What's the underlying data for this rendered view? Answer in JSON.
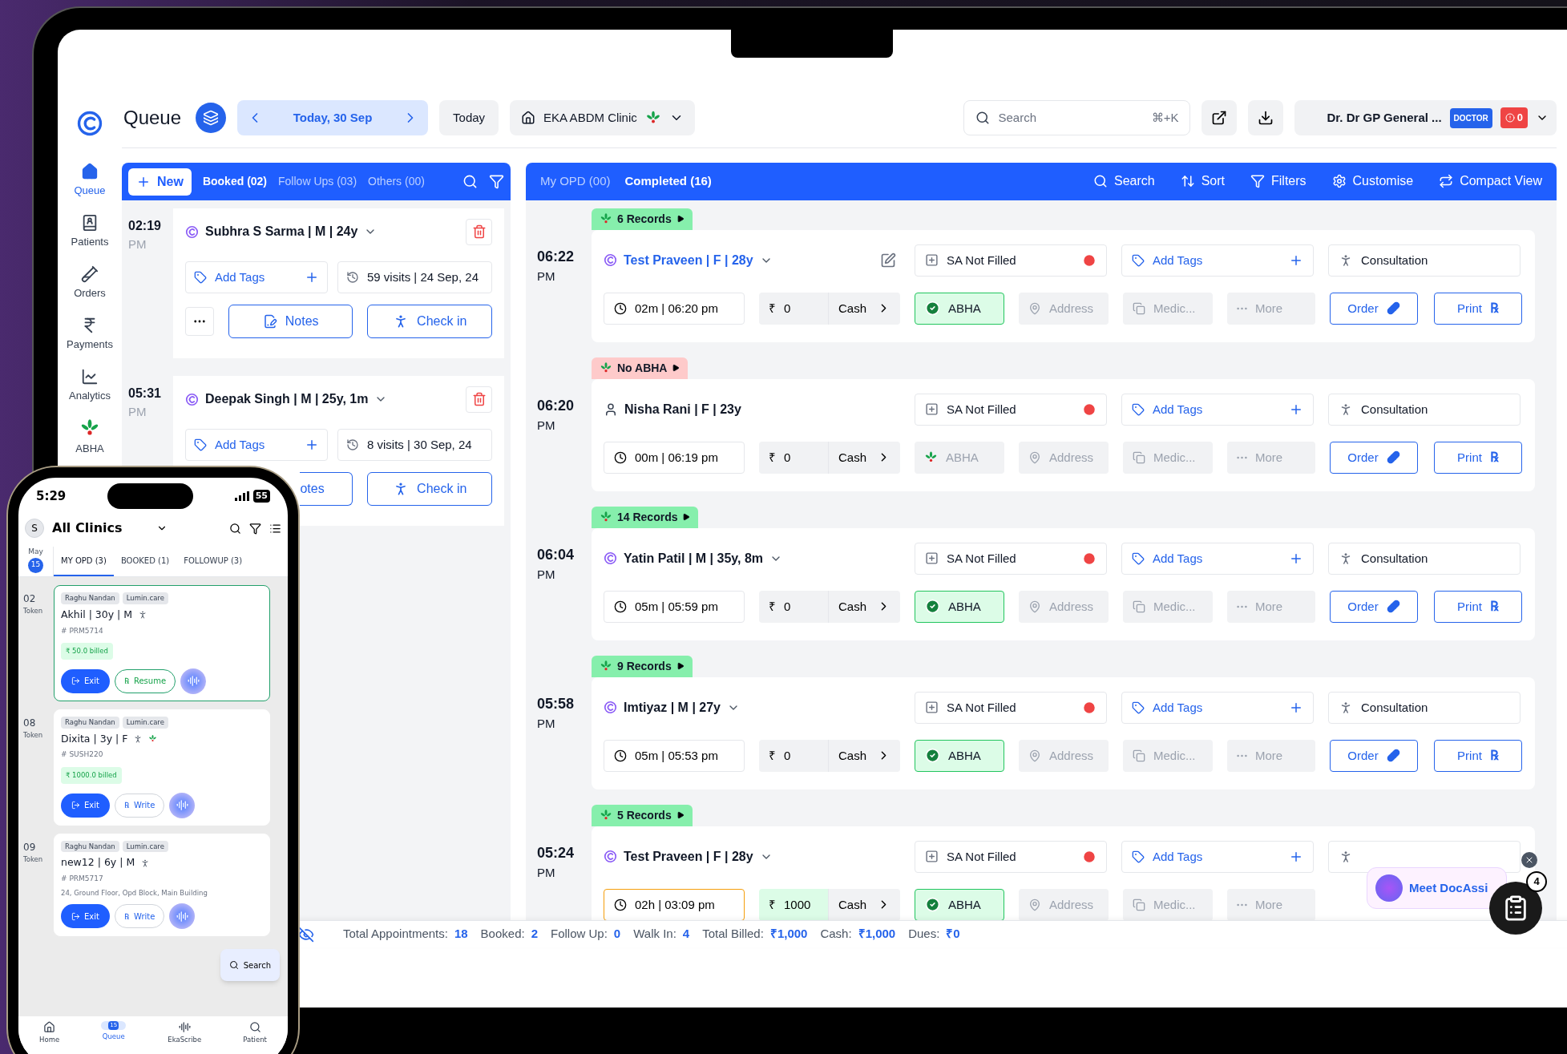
{
  "header": {
    "title": "Queue",
    "date": "Today, 30 Sep",
    "today_button": "Today",
    "clinic": "EKA ABDM Clinic",
    "search_placeholder": "Search",
    "shortcut": "⌘+K",
    "doctor": "Dr. Dr GP General ...",
    "role_badge": "DOCTOR",
    "alert_count": "0"
  },
  "sidebar": {
    "items": [
      {
        "label": "Queue",
        "selected": true
      },
      {
        "label": "Patients",
        "selected": false
      },
      {
        "label": "Orders",
        "selected": false
      },
      {
        "label": "Payments",
        "selected": false
      },
      {
        "label": "Analytics",
        "selected": false
      },
      {
        "label": "ABHA",
        "selected": false
      }
    ]
  },
  "booked_panel": {
    "new_button": "New",
    "tabs": [
      {
        "label": "Booked (02)",
        "selected": true
      },
      {
        "label": "Follow Ups (03)",
        "selected": false
      },
      {
        "label": "Others (00)",
        "selected": false
      }
    ],
    "appointments": [
      {
        "time": "02:19",
        "meridiem": "PM",
        "name": "Subhra S Sarma | M | 24y",
        "tags": "Add Tags",
        "visits": "59 visits | 24 Sep, 24",
        "notes": "Notes",
        "check_in": "Check in",
        "partly_hidden": false
      },
      {
        "time": "05:31",
        "meridiem": "PM",
        "name": "Deepak Singh | M | 25y, 1m",
        "tags": "Add Tags",
        "visits": "8 visits | 30 Sep, 24",
        "notes": "otes",
        "check_in": "Check in",
        "partly_hidden": true
      }
    ]
  },
  "completed_panel": {
    "tabs": [
      {
        "label": "My OPD (00)",
        "selected": false
      },
      {
        "label": "Completed (16)",
        "selected": true
      }
    ],
    "actions": [
      "Search",
      "Sort",
      "Filters",
      "Customise",
      "Compact View"
    ],
    "records": [
      {
        "badge": "6 Records",
        "badge_warning": false,
        "time": "06:22",
        "meridiem": "PM",
        "kind": "eka",
        "selected": true,
        "name": "Test Praveen | F | 28y",
        "sa": "SA Not Filled",
        "tags": "Add Tags",
        "visit_type": "Consultation",
        "duration": "02m | 06:20 pm",
        "overdue": false,
        "currency": "₹",
        "amount": "0",
        "paid": false,
        "payment": "Cash",
        "abha": "ABHA",
        "abha_linked": true,
        "address": "Address",
        "medic": "Medic...",
        "more": "More",
        "order": "Order",
        "print": "Print",
        "rx_mark": "℞"
      },
      {
        "badge": "No ABHA",
        "badge_warning": true,
        "time": "06:20",
        "meridiem": "PM",
        "kind": "guest",
        "selected": false,
        "name": "Nisha Rani | F | 23y",
        "sa": "SA Not Filled",
        "tags": "Add Tags",
        "visit_type": "Consultation",
        "duration": "00m | 06:19 pm",
        "overdue": false,
        "currency": "₹",
        "amount": "0",
        "paid": false,
        "payment": "Cash",
        "abha": "ABHA",
        "abha_linked": false,
        "address": "Address",
        "medic": "Medic...",
        "more": "More",
        "order": "Order",
        "print": "Print",
        "rx_mark": "℞"
      },
      {
        "badge": "14 Records",
        "badge_warning": false,
        "time": "06:04",
        "meridiem": "PM",
        "kind": "eka",
        "selected": false,
        "name": "Yatin Patil | M | 35y, 8m",
        "sa": "SA Not Filled",
        "tags": "Add Tags",
        "visit_type": "Consultation",
        "duration": "05m | 05:59 pm",
        "overdue": false,
        "currency": "₹",
        "amount": "0",
        "paid": false,
        "payment": "Cash",
        "abha": "ABHA",
        "abha_linked": true,
        "address": "Address",
        "medic": "Medic...",
        "more": "More",
        "order": "Order",
        "print": "Print",
        "rx_mark": "℞"
      },
      {
        "badge": "9 Records",
        "badge_warning": false,
        "time": "05:58",
        "meridiem": "PM",
        "kind": "eka",
        "selected": false,
        "name": "Imtiyaz | M | 27y",
        "sa": "SA Not Filled",
        "tags": "Add Tags",
        "visit_type": "Consultation",
        "duration": "05m | 05:53 pm",
        "overdue": false,
        "currency": "₹",
        "amount": "0",
        "paid": false,
        "payment": "Cash",
        "abha": "ABHA",
        "abha_linked": true,
        "address": "Address",
        "medic": "Medic...",
        "more": "More",
        "order": "Order",
        "print": "Print",
        "rx_mark": "℞"
      },
      {
        "badge": "5 Records",
        "badge_warning": false,
        "time": "05:24",
        "meridiem": "PM",
        "kind": "eka",
        "selected": false,
        "name": "Test Praveen | F | 28y",
        "sa": "SA Not Filled",
        "tags": "Add Tags",
        "duration": "02h | 03:09 pm",
        "overdue": true,
        "currency": "₹",
        "amount": "1000",
        "paid": true,
        "payment": "Cash",
        "abha": "ABHA",
        "abha_linked": true,
        "address": "Address",
        "medic": "Medic...",
        "more": "More"
      }
    ]
  },
  "status_bar": [
    {
      "label": "Total Appointments:",
      "value": "18"
    },
    {
      "label": "Booked:",
      "value": "2"
    },
    {
      "label": "Follow Up:",
      "value": "0"
    },
    {
      "label": "Walk In:",
      "value": "4"
    },
    {
      "label": "Total Billed:",
      "value": "₹1,000"
    },
    {
      "label": "Cash:",
      "value": "₹1,000"
    },
    {
      "label": "Dues:",
      "value": "₹0"
    }
  ],
  "assistant": {
    "label": "Meet DocAssi",
    "count": "4"
  },
  "phone": {
    "time": "5:29",
    "battery": "55",
    "avatar": "S",
    "clinic": "All Clinics",
    "month": "May",
    "day": "15",
    "tabs": [
      {
        "label": "MY OPD (3)",
        "selected": true
      },
      {
        "label": "BOOKED (1)",
        "selected": false
      },
      {
        "label": "FOLLOWUP (3)",
        "selected": false
      }
    ],
    "tokens": [
      {
        "token": "02",
        "token_label": "Token",
        "tags": [
          "Raghu Nandan",
          "Lumin.care"
        ],
        "name": "Akhil | 30y | M",
        "abha": false,
        "id": "# PRM5714",
        "billed": "₹  50.0 billed",
        "exit": "Exit",
        "rx_mark": "℞",
        "rx": "Resume",
        "selected": true
      },
      {
        "token": "08",
        "token_label": "Token",
        "tags": [
          "Raghu Nandan",
          "Lumin.care"
        ],
        "name": "Dixita | 3y | F",
        "abha": true,
        "id": "# SUSH220",
        "billed": "₹  1000.0 billed",
        "exit": "Exit",
        "rx_mark": "℞",
        "rx": "Write",
        "selected": false
      },
      {
        "token": "09",
        "token_label": "Token",
        "tags": [
          "Raghu Nandan",
          "Lumin.care"
        ],
        "name": "new12 | 6y | M",
        "abha": false,
        "id": "# PRM5717",
        "address": "24, Ground Floor, Opd Block, Main Building",
        "exit": "Exit",
        "rx_mark": "℞",
        "rx": "Write",
        "selected": false
      }
    ],
    "search_button": "Search",
    "nav": [
      {
        "label": "Home",
        "selected": false
      },
      {
        "label": "Queue",
        "selected": true,
        "badge": "15"
      },
      {
        "label": "EkaScribe",
        "selected": false
      },
      {
        "label": "Patient",
        "selected": false
      }
    ]
  }
}
